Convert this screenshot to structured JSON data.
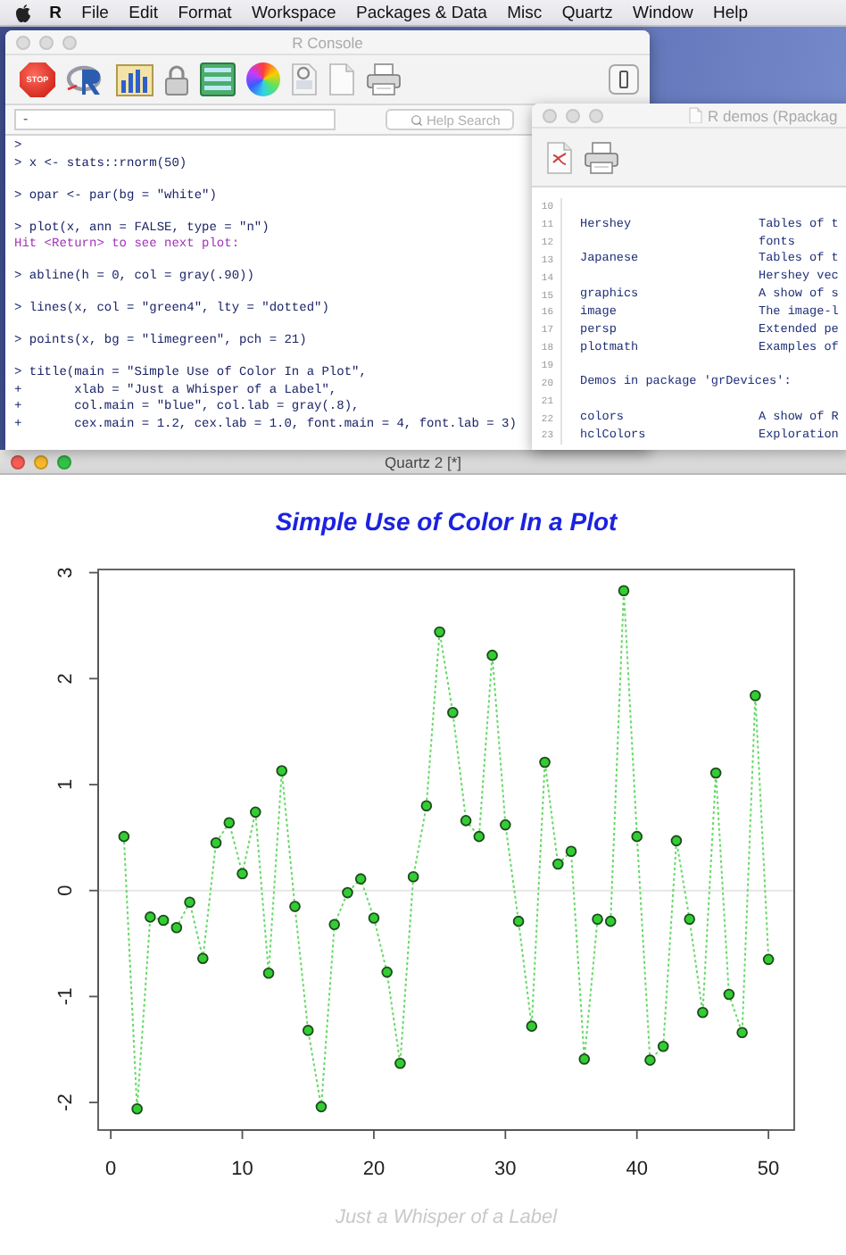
{
  "menu_bar": {
    "items": [
      {
        "label": "R",
        "bold": true
      },
      {
        "label": "File",
        "bold": false
      },
      {
        "label": "Edit",
        "bold": false
      },
      {
        "label": "Format",
        "bold": false
      },
      {
        "label": "Workspace",
        "bold": false
      },
      {
        "label": "Packages & Data",
        "bold": false
      },
      {
        "label": "Misc",
        "bold": false
      },
      {
        "label": "Quartz",
        "bold": false
      },
      {
        "label": "Window",
        "bold": false
      },
      {
        "label": "Help",
        "bold": false
      }
    ]
  },
  "console_window": {
    "title": "R Console",
    "active": false,
    "stop_label": "STOP",
    "history_field": {
      "value": "-"
    },
    "search_field": {
      "placeholder": "Help Search"
    },
    "blocks": [
      {
        "lines": [
          {
            "kind": "input",
            "text": ">"
          },
          {
            "kind": "input",
            "text": "> x <- stats::rnorm(50)"
          }
        ]
      },
      {
        "lines": [
          {
            "kind": "input",
            "text": "> opar <- par(bg = \"white\")"
          }
        ]
      },
      {
        "lines": [
          {
            "kind": "input",
            "text": "> plot(x, ann = FALSE, type = \"n\")"
          },
          {
            "kind": "output",
            "text": "Hit <Return> to see next plot:"
          }
        ]
      },
      {
        "lines": [
          {
            "kind": "input",
            "text": "> abline(h = 0, col = gray(.90))"
          }
        ]
      },
      {
        "lines": [
          {
            "kind": "input",
            "text": "> lines(x, col = \"green4\", lty = \"dotted\")"
          }
        ]
      },
      {
        "lines": [
          {
            "kind": "input",
            "text": "> points(x, bg = \"limegreen\", pch = 21)"
          }
        ]
      },
      {
        "lines": [
          {
            "kind": "input",
            "text": "> title(main = \"Simple Use of Color In a Plot\","
          },
          {
            "kind": "input",
            "text": "+       xlab = \"Just a Whisper of a Label\","
          },
          {
            "kind": "input",
            "text": "+       col.main = \"blue\", col.lab = gray(.8),"
          },
          {
            "kind": "input",
            "text": "+       cex.main = 1.2, cex.lab = 1.0, font.main = 4, font.lab = 3)"
          }
        ]
      }
    ]
  },
  "demos_window": {
    "title": "R demos (Rpackag",
    "active": false,
    "lines": [
      {
        "number": "10"
      },
      {
        "number": "11",
        "name": "Hershey",
        "description": "Tables of t"
      },
      {
        "number": "12",
        "description": "fonts"
      },
      {
        "number": "13",
        "name": "Japanese",
        "description": "Tables of t"
      },
      {
        "number": "14",
        "description": "Hershey vec"
      },
      {
        "number": "15",
        "name": "graphics",
        "description": "A show of s"
      },
      {
        "number": "16",
        "name": "image",
        "description": "The image-l"
      },
      {
        "number": "17",
        "name": "persp",
        "description": "Extended pe"
      },
      {
        "number": "18",
        "name": "plotmath",
        "description": "Examples of"
      },
      {
        "number": "19"
      },
      {
        "number": "20",
        "heading": "Demos in package 'grDevices':"
      },
      {
        "number": "21"
      },
      {
        "number": "22",
        "name": "colors",
        "description": "A show of R"
      },
      {
        "number": "23",
        "name": "hclColors",
        "description": "Exploration"
      }
    ]
  },
  "quartz_window": {
    "title": "Quartz 2 [*]",
    "active": true,
    "chart_data": {
      "type": "line",
      "title": "Simple Use of Color In a Plot",
      "xlabel": "Just a Whisper of a Label",
      "x": [
        1,
        2,
        3,
        4,
        5,
        6,
        7,
        8,
        9,
        10,
        11,
        12,
        13,
        14,
        15,
        16,
        17,
        18,
        19,
        20,
        21,
        22,
        23,
        24,
        25,
        26,
        27,
        28,
        29,
        30,
        31,
        32,
        33,
        34,
        35,
        36,
        37,
        38,
        39,
        40,
        41,
        42,
        43,
        44,
        45,
        46,
        47,
        48,
        49,
        50
      ],
      "series": [
        {
          "color": "#32cd32",
          "line_style": "dotted",
          "marker": "circle",
          "values": [
            0.51,
            -2.06,
            -0.25,
            -0.28,
            -0.35,
            -0.11,
            -0.64,
            0.45,
            0.64,
            0.16,
            0.74,
            -0.78,
            1.13,
            -0.15,
            -1.32,
            -2.04,
            -0.32,
            -0.02,
            0.11,
            -0.26,
            -0.77,
            -1.63,
            0.13,
            0.8,
            2.44,
            1.68,
            0.66,
            0.51,
            2.22,
            0.62,
            -0.29,
            -1.28,
            1.21,
            0.25,
            0.37,
            -1.59,
            -0.27,
            -0.29,
            2.83,
            0.51,
            -1.6,
            -1.47,
            0.47,
            -0.27,
            -1.15,
            1.11,
            -0.98,
            -1.34,
            1.84,
            -0.65
          ]
        }
      ],
      "xlim": [
        -0.96,
        51.96
      ],
      "ylim": [
        -2.26,
        3.03
      ],
      "xticks": [
        0,
        10,
        20,
        30,
        40,
        50
      ],
      "yticks": [
        -2,
        -1,
        0,
        1,
        2,
        3
      ]
    }
  }
}
